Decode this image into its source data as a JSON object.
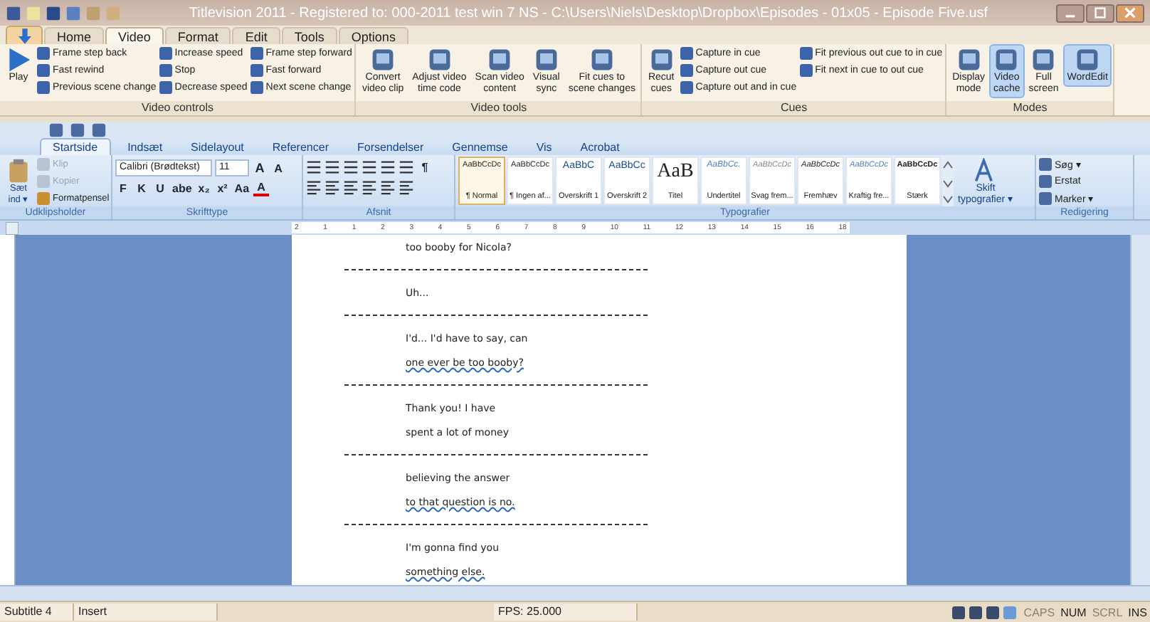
{
  "window": {
    "title": "Titlevision 2011 - Registered to: 000-2011 test win 7 NS - C:\\Users\\Niels\\Desktop\\Dropbox\\Episodes - 01x05 - Episode Five.usf"
  },
  "tabs": [
    {
      "label": "Home",
      "selected": false
    },
    {
      "label": "Video",
      "selected": true
    },
    {
      "label": "Format",
      "selected": false
    },
    {
      "label": "Edit",
      "selected": false
    },
    {
      "label": "Tools",
      "selected": false
    },
    {
      "label": "Options",
      "selected": false
    }
  ],
  "ribbon_groups": [
    {
      "label": "Video controls",
      "columns": [
        {
          "kind": "big",
          "label": "Play",
          "selected": false
        },
        {
          "kind": "stack",
          "items": [
            "Frame step back",
            "Fast rewind",
            "Previous scene change"
          ]
        },
        {
          "kind": "stack",
          "items": [
            "Increase speed",
            "Stop",
            "Decrease speed"
          ]
        },
        {
          "kind": "stack",
          "items": [
            "Frame step forward",
            "Fast forward",
            "Next scene change"
          ]
        }
      ]
    },
    {
      "label": "Video tools",
      "columns": [
        {
          "kind": "big",
          "label": "Convert\nvideo clip",
          "selected": false
        },
        {
          "kind": "big",
          "label": "Adjust video\ntime code",
          "selected": false
        },
        {
          "kind": "big",
          "label": "Scan video\ncontent",
          "selected": false
        },
        {
          "kind": "big",
          "label": "Visual\nsync",
          "selected": false
        },
        {
          "kind": "big",
          "label": "Fit cues to\nscene changes",
          "selected": false
        }
      ]
    },
    {
      "label": "Cues",
      "columns": [
        {
          "kind": "big",
          "label": "Recut\ncues",
          "selected": false
        },
        {
          "kind": "stack",
          "items": [
            "Capture in cue",
            "Capture out cue",
            "Capture out and in cue"
          ]
        },
        {
          "kind": "stack",
          "items": [
            "Fit previous out cue to in cue",
            "Fit next in cue to out cue"
          ]
        }
      ]
    },
    {
      "label": "Modes",
      "columns": [
        {
          "kind": "big",
          "label": "Display\nmode",
          "selected": false
        },
        {
          "kind": "big",
          "label": "Video\ncache",
          "selected": true
        },
        {
          "kind": "big",
          "label": "Full\nscreen",
          "selected": false
        },
        {
          "kind": "big",
          "label": "WordEdit",
          "selected": true
        }
      ]
    }
  ],
  "word": {
    "tabs": [
      {
        "label": "Startside",
        "selected": true
      },
      {
        "label": "Indsæt",
        "selected": false
      },
      {
        "label": "Sidelayout",
        "selected": false
      },
      {
        "label": "Referencer",
        "selected": false
      },
      {
        "label": "Forsendelser",
        "selected": false
      },
      {
        "label": "Gennemse",
        "selected": false
      },
      {
        "label": "Vis",
        "selected": false
      },
      {
        "label": "Acrobat",
        "selected": false
      }
    ],
    "clipboard": {
      "label": "Udklipsholder",
      "paste": "Sæt\nind ▾",
      "items": [
        {
          "label": "Klip",
          "disabled": true
        },
        {
          "label": "Kopier",
          "disabled": true
        },
        {
          "label": "Formatpensel",
          "disabled": false
        }
      ]
    },
    "font": {
      "label": "Skrifttype",
      "family": "Calibri (Brødtekst)",
      "size": "11",
      "grow": "A",
      "shrink": "A",
      "formats": [
        "F",
        "K",
        "U",
        "abe",
        "x₂",
        "x²",
        "Aa"
      ],
      "color_letter": "A"
    },
    "paragraph": {
      "label": "Afsnit",
      "pilcrow": "¶"
    },
    "styles": {
      "label": "Typografier",
      "items": [
        {
          "sample": "AaBbCcDc",
          "name": "¶ Normal",
          "selected": true
        },
        {
          "sample": "AaBbCcDc",
          "name": "¶ Ingen af...",
          "selected": false
        },
        {
          "sample": "AaBbC",
          "name": "Overskrift 1",
          "selected": false
        },
        {
          "sample": "AaBbCc",
          "name": "Overskrift 2",
          "selected": false
        },
        {
          "sample": "AaB",
          "name": "Titel",
          "selected": false
        },
        {
          "sample": "AaBbCc.",
          "name": "Undertitel",
          "selected": false
        },
        {
          "sample": "AaBbCcDc",
          "name": "Svag frem...",
          "selected": false
        },
        {
          "sample": "AaBbCcDc",
          "name": "Fremhæv",
          "selected": false
        },
        {
          "sample": "AaBbCcDc",
          "name": "Kraftig fre...",
          "selected": false
        },
        {
          "sample": "AaBbCcDc",
          "name": "Stærk",
          "selected": false
        }
      ],
      "change": "Skift\ntypografier ▾"
    },
    "editing": {
      "label": "Redigering",
      "items": [
        "Søg ▾",
        "Erstat",
        "Marker ▾"
      ]
    },
    "ruler": [
      "2",
      "1",
      "1",
      "2",
      "3",
      "4",
      "5",
      "6",
      "7",
      "8",
      "9",
      "10",
      "11",
      "12",
      "13",
      "14",
      "15",
      "16",
      "18"
    ],
    "document": [
      {
        "kind": "line",
        "text": "too booby for Nicola?",
        "flagged": false
      },
      {
        "kind": "separator"
      },
      {
        "kind": "line",
        "text": "Uh...",
        "flagged": false
      },
      {
        "kind": "separator"
      },
      {
        "kind": "line",
        "text": "I'd... I'd have to say, can",
        "flagged": false
      },
      {
        "kind": "line",
        "text": "one ever be too booby?",
        "flagged": true
      },
      {
        "kind": "separator"
      },
      {
        "kind": "line",
        "text": "Thank you! I have",
        "flagged": false
      },
      {
        "kind": "line",
        "text": "spent a lot of money",
        "flagged": false
      },
      {
        "kind": "separator"
      },
      {
        "kind": "line",
        "text": "believing the answer",
        "flagged": false
      },
      {
        "kind": "line",
        "text": "to that question is no.",
        "flagged": true
      },
      {
        "kind": "separator"
      },
      {
        "kind": "line",
        "text": "I'm gonna find you",
        "flagged": false
      },
      {
        "kind": "line",
        "text": "something else.",
        "flagged": true
      }
    ]
  },
  "status_bar": {
    "cells": [
      "Subtitle 4",
      "Insert",
      "FPS: 25.000"
    ],
    "indicators": [
      {
        "label": "CAPS",
        "on": false
      },
      {
        "label": "NUM",
        "on": true
      },
      {
        "label": "SCRL",
        "on": false
      },
      {
        "label": "INS",
        "on": true
      }
    ]
  }
}
